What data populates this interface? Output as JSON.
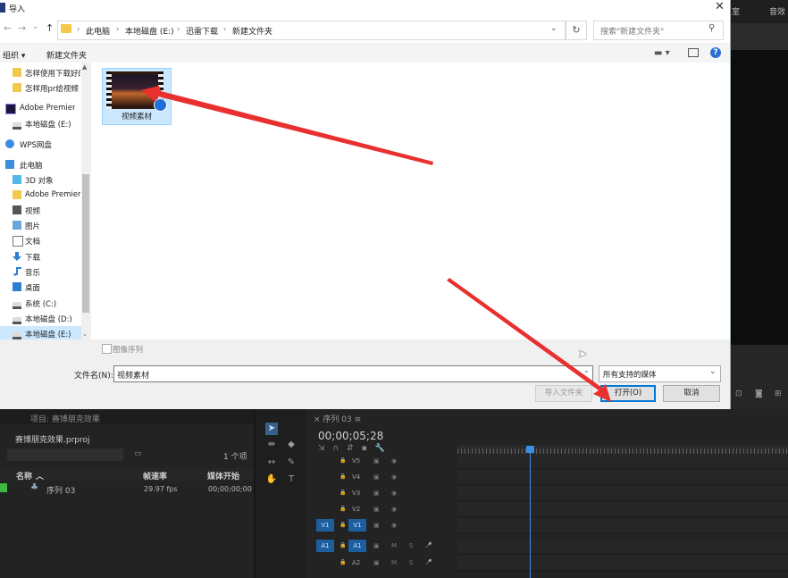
{
  "premiere": {
    "top_tabs": [
      "室",
      "音效"
    ],
    "project": {
      "tab_label": "项目: 赛博朋克效果",
      "file_name": "赛博朋克效果.prproj",
      "item_count": "1 个项",
      "columns": [
        "名称",
        "帧速率",
        "媒体开始"
      ],
      "rows": [
        {
          "name": "序列 03",
          "fps": "29.97 fps",
          "start": "00;00;00;00"
        }
      ]
    },
    "timeline": {
      "tab_label": "序列 03",
      "timecode": "00;00;05;28",
      "video_tracks": [
        "V5",
        "V4",
        "V3",
        "V2",
        "V1"
      ],
      "audio_tracks": [
        "A1",
        "A2"
      ],
      "source_v": "V1",
      "source_a": "A1",
      "track_flags": [
        "M",
        "S"
      ]
    },
    "playhead_color": "#3d8ee6"
  },
  "dialog": {
    "title": "导入",
    "close_label": "✕",
    "nav": {
      "back": "←",
      "forward": "→",
      "history": "⌄",
      "up": "↑",
      "refresh": "↻"
    },
    "breadcrumb": [
      "此电脑",
      "本地磁盘 (E:)",
      "迅雷下载",
      "新建文件夹"
    ],
    "search_placeholder": "搜索\"新建文件夹\"",
    "toolbar": {
      "organize": "组织 ▾",
      "new_folder": "新建文件夹"
    },
    "nav_items": [
      {
        "label": "怎样使用下载好的",
        "icon": "folder-icon",
        "selected": false
      },
      {
        "label": "怎样用pr给视频",
        "icon": "folder-icon",
        "selected": false
      },
      {
        "label": "Adobe Premiere",
        "icon": "premiere-icon",
        "selected": false
      },
      {
        "label": "本地磁盘 (E:)",
        "icon": "drive-icon",
        "selected": false
      },
      {
        "label": "WPS网盘",
        "icon": "cloud-icon",
        "selected": false
      },
      {
        "label": "此电脑",
        "icon": "computer-icon",
        "selected": false
      },
      {
        "label": "3D 对象",
        "icon": "cube-icon",
        "selected": false
      },
      {
        "label": "Adobe Premiere",
        "icon": "folder-icon",
        "selected": false
      },
      {
        "label": "视频",
        "icon": "video-icon",
        "selected": false
      },
      {
        "label": "图片",
        "icon": "picture-icon",
        "selected": false
      },
      {
        "label": "文档",
        "icon": "document-icon",
        "selected": false
      },
      {
        "label": "下载",
        "icon": "download-icon",
        "selected": false
      },
      {
        "label": "音乐",
        "icon": "music-icon",
        "selected": false
      },
      {
        "label": "桌面",
        "icon": "desktop-icon",
        "selected": false
      },
      {
        "label": "系统 (C:)",
        "icon": "drive-icon",
        "selected": false
      },
      {
        "label": "本地磁盘 (D:)",
        "icon": "drive-icon",
        "selected": false
      },
      {
        "label": "本地磁盘 (E:)",
        "icon": "drive-icon",
        "selected": true
      }
    ],
    "file": {
      "name": "视频素材"
    },
    "image_sequence_label": "图像序列",
    "filename_label": "文件名(N):",
    "filename_value": "视频素材",
    "filter_value": "所有支持的媒体",
    "buttons": {
      "import_folder": "导入文件夹",
      "open": "打开(O)",
      "cancel": "取消"
    }
  },
  "annotation_color": "#e8312f"
}
